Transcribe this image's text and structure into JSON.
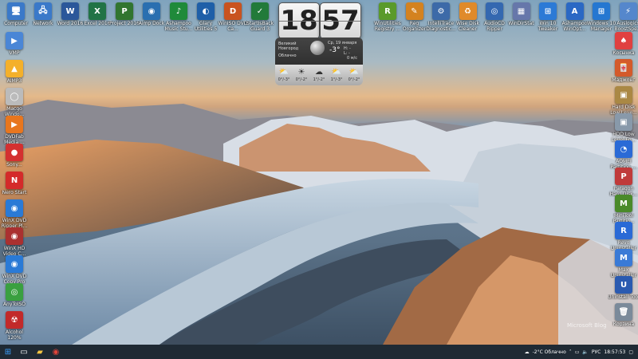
{
  "top_icons": [
    {
      "id": "computer",
      "label": "Computer",
      "color": "#3a79c9",
      "glyph": "🖥"
    },
    {
      "id": "network",
      "label": "Network",
      "color": "#3a79c9",
      "glyph": "🖧"
    },
    {
      "id": "word",
      "label": "Word 2016",
      "color": "#2b579a",
      "glyph": "W"
    },
    {
      "id": "excel",
      "label": "Excel 2016",
      "color": "#217346",
      "glyph": "X"
    },
    {
      "id": "project",
      "label": "Project 2016",
      "color": "#31752f",
      "glyph": "P"
    },
    {
      "id": "aimp",
      "label": "Aimp Dock",
      "color": "#2a6fb0",
      "glyph": "◉"
    },
    {
      "id": "ashampoo",
      "label": "Ashampoo Music Stu...",
      "color": "#1f8a3a",
      "glyph": "♪"
    },
    {
      "id": "glary",
      "label": "Glary Utilities 5",
      "color": "#1e5fa8",
      "glyph": "◐"
    },
    {
      "id": "winiso",
      "label": "WinISO DVD Ca...",
      "color": "#c9531f",
      "glyph": "D"
    },
    {
      "id": "startisback",
      "label": "StartIsBack Guard 3",
      "color": "#227a3a",
      "glyph": "✓"
    }
  ],
  "top_right_icons": [
    {
      "id": "winutilities",
      "label": "WinUtilities Registry ...",
      "color": "#5a9a2a",
      "glyph": "R"
    },
    {
      "id": "regorg",
      "label": "Reg Organizer",
      "color": "#d4821f",
      "glyph": "✎"
    },
    {
      "id": "hdtune",
      "label": "IntelliTrace Diagnostic...",
      "color": "#3d6aa8",
      "glyph": "⚙"
    },
    {
      "id": "wisedisk",
      "label": "Wise Disk Cleaner",
      "color": "#e08a2a",
      "glyph": "♻"
    },
    {
      "id": "audiocd",
      "label": "AudioCD Ripper",
      "color": "#3468b0",
      "glyph": "◎"
    },
    {
      "id": "windirstat",
      "label": "WinDirStat",
      "color": "#6677aa",
      "glyph": "▦"
    },
    {
      "id": "win10tweaker",
      "label": "Win 10 Tweaker",
      "color": "#2c7ad6",
      "glyph": "⊞"
    },
    {
      "id": "ashampoo-win",
      "label": "Ashampoo WinOpt...",
      "color": "#2a68c4",
      "glyph": "A"
    },
    {
      "id": "win10manager",
      "label": "Windows 10 Manager",
      "color": "#2577d1",
      "glyph": "⊞"
    },
    {
      "id": "auslogics",
      "label": "Auslogics BoostSpe...",
      "color": "#5587cc",
      "glyph": "⚡"
    }
  ],
  "left_icons": [
    {
      "id": "vmp",
      "label": "VMP",
      "color": "#4a86d6",
      "glyph": "▶"
    },
    {
      "id": "aimp2",
      "label": "AIMP3",
      "color": "#f4b02a",
      "glyph": "▲"
    },
    {
      "id": "macgo",
      "label": "Macgo Windo...",
      "color": "#bbbbbb",
      "glyph": "◯"
    },
    {
      "id": "dvdfab",
      "label": "DVDFab Media ...",
      "color": "#e8761e",
      "glyph": "▶"
    },
    {
      "id": "aiseesoft",
      "label": "Sony...",
      "color": "#d43030",
      "glyph": "●"
    },
    {
      "id": "nero",
      "label": "Nero Start",
      "color": "#d42a2a",
      "glyph": "N"
    },
    {
      "id": "winxdvd",
      "label": "WinX DVD Ripper Pl...",
      "color": "#2a7ad6",
      "glyph": "◉"
    },
    {
      "id": "winxhd",
      "label": "WinX HD Video C...",
      "color": "#aa3030",
      "glyph": "◉"
    },
    {
      "id": "winxcopy",
      "label": "WinX DVD Copy Pro",
      "color": "#2a7ad6",
      "glyph": "◉"
    },
    {
      "id": "anytoiso",
      "label": "AnyToISO",
      "color": "#3aa040",
      "glyph": "◎"
    },
    {
      "id": "alcohol",
      "label": "Alcohol 120%",
      "color": "#c22a2a",
      "glyph": "☢"
    }
  ],
  "right_icons": [
    {
      "id": "kosynka",
      "label": "Косынка",
      "color": "#e04040",
      "glyph": "♠"
    },
    {
      "id": "mahjong",
      "label": "Маджонг",
      "color": "#d45a2a",
      "glyph": "🀄"
    },
    {
      "id": "harddisk",
      "label": "Hard Disk Low Leve...",
      "color": "#aa8844",
      "glyph": "▣"
    },
    {
      "id": "hdd",
      "label": "HDD Low Level Fo...",
      "color": "#8899aa",
      "glyph": "▣"
    },
    {
      "id": "aomei",
      "label": "AOMEI Partition ...",
      "color": "#2a6ad6",
      "glyph": "◔"
    },
    {
      "id": "paragon",
      "label": "Paragon Hard Disk...",
      "color": "#c03a3a",
      "glyph": "P"
    },
    {
      "id": "minitool",
      "label": "MiniTool Partitio...",
      "color": "#4a8a2a",
      "glyph": "M"
    },
    {
      "id": "revo",
      "label": "Revo Uninstaller",
      "color": "#2a6ad6",
      "glyph": "R"
    },
    {
      "id": "max",
      "label": "Max Uninstaller",
      "color": "#3a7ad6",
      "glyph": "M"
    },
    {
      "id": "uninstall",
      "label": "Uninstall Tool",
      "color": "#2a5ab0",
      "glyph": "U"
    },
    {
      "id": "recycle",
      "label": "Корзина",
      "color": "#7a8a9a",
      "glyph": "🗑"
    }
  ],
  "clock": {
    "hours": "18",
    "minutes": "57",
    "city": "Великий Новгород",
    "condition": "Облачно",
    "date": "Ср, 19 января",
    "temp": "-3°",
    "hi": "H: -",
    "lo": "L: -",
    "wind": "0 м/с"
  },
  "forecast": [
    {
      "icon": "⛅",
      "t": "0°/-3°"
    },
    {
      "icon": "☀",
      "t": "0°/-2°"
    },
    {
      "icon": "☁",
      "t": "1°/-2°"
    },
    {
      "icon": "⛅",
      "t": "1°/-3°"
    },
    {
      "icon": "⛅",
      "t": "0°/-2°"
    }
  ],
  "watermark": "Microsoft Blog",
  "taskbar": {
    "weather": "-2°C Облачно",
    "lang": "РУС",
    "time": "18:57:53"
  }
}
